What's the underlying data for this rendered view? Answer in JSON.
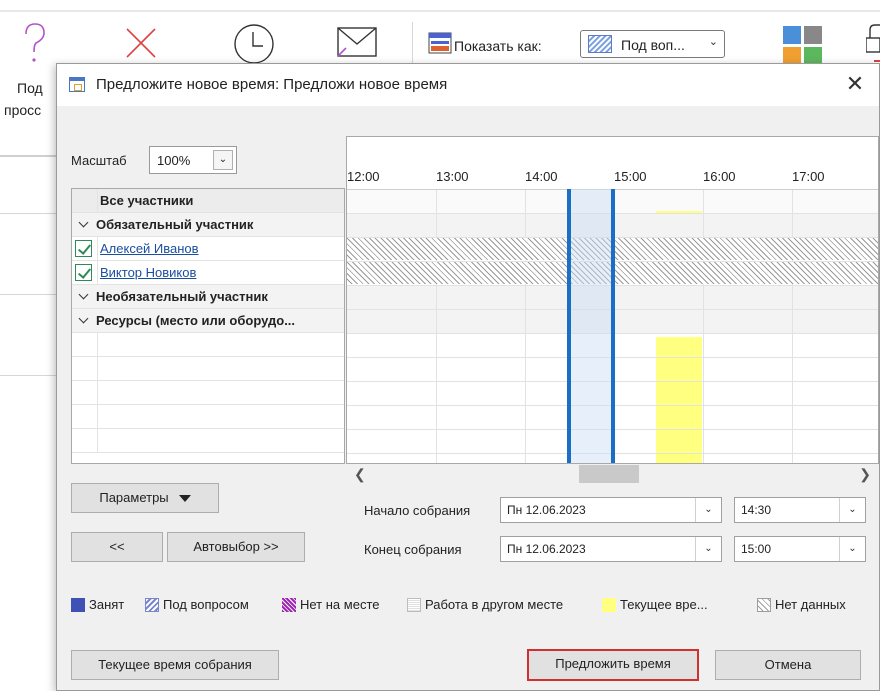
{
  "background": {
    "left_labels": [
      "Под",
      "просс"
    ],
    "show_as_label": "Показать как:",
    "show_as_value": "Под воп..."
  },
  "dialog": {
    "title": "Предложите новое время:  Предложи новое время",
    "close_icon": "close-icon",
    "zoom": {
      "label": "Масштаб",
      "value": "100%"
    },
    "attendees": {
      "header": "Все участники",
      "required_group": "Обязательный участник",
      "required": [
        "Алексей Иванов",
        "Виктор Новиков"
      ],
      "optional_group": "Необязательный участник",
      "resources_group": "Ресурсы (место или оборудо..."
    },
    "timeline": {
      "hours": [
        "12:00",
        "13:00",
        "14:00",
        "15:00",
        "16:00",
        "17:00"
      ]
    },
    "buttons": {
      "options": "Параметры",
      "prev": "<<",
      "autopick": "Автовыбор >>",
      "current_time": "Текущее время собрания",
      "propose": "Предложить время",
      "cancel": "Отмена"
    },
    "start": {
      "label": "Начало собрания",
      "date": "Пн 12.06.2023",
      "time": "14:30"
    },
    "end": {
      "label": "Конец собрания",
      "date": "Пн 12.06.2023",
      "time": "15:00"
    },
    "legend": [
      {
        "label": "Занят",
        "color": "#3f51b5",
        "icon": "busy-swatch"
      },
      {
        "label": "Под вопросом",
        "color": "#7986cb",
        "icon": "tentative-swatch"
      },
      {
        "label": "Нет на месте",
        "color": "#9c27b0",
        "icon": "out-of-office-swatch"
      },
      {
        "label": "Работа в другом месте",
        "color": "#bdbdbd",
        "icon": "working-elsewhere-swatch"
      },
      {
        "label": "Текущее вре...",
        "color": "#ffff80",
        "icon": "current-time-swatch"
      },
      {
        "label": "Нет данных",
        "color": "#9e9e9e",
        "icon": "no-info-swatch"
      }
    ]
  }
}
